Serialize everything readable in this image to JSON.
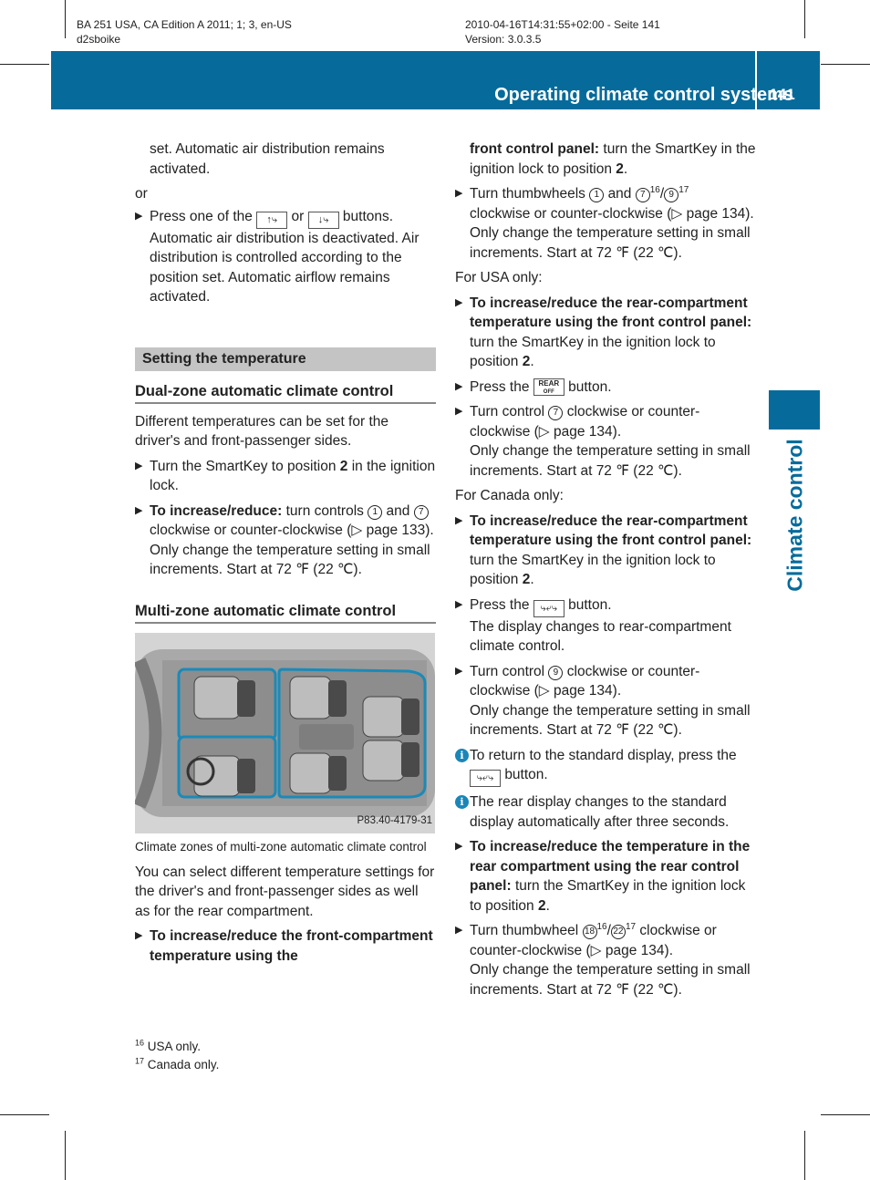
{
  "meta": {
    "left_line1": "BA 251 USA, CA Edition A 2011; 1; 3, en-US",
    "left_line2": "d2sboike",
    "right_line1": "2010-04-16T14:31:55+02:00 - Seite 141",
    "right_line2": "Version: 3.0.3.5"
  },
  "header": {
    "title": "Operating climate control systems",
    "page": "141"
  },
  "side_tab": {
    "label": "Climate control"
  },
  "colors": {
    "brand_blue": "#066b9b",
    "section_gray": "#c4c4c4"
  },
  "left": {
    "cont": "set. Automatic air distribution remains activated.",
    "or": "or",
    "step_press_pre": "Press one of the",
    "btn_a": "↑⤷",
    "step_press_mid": "or",
    "btn_b": "↓⤷",
    "step_press_post": "buttons.",
    "step_press_body": "Automatic air distribution is deactivated. Air distribution is controlled according to the position set. Automatic airflow remains activated.",
    "section_title": "Setting the temperature",
    "dual_heading": "Dual-zone automatic climate control",
    "dual_intro": "Different temperatures can be set for the driver's and front-passenger sides.",
    "dual_step1_pre": "Turn the SmartKey to position",
    "dual_step1_bold": "2",
    "dual_step1_post": "in the ignition lock.",
    "dual_step2_bold": "To increase/reduce:",
    "dual_step2_a": "turn controls",
    "c1": "1",
    "dual_step2_b": "and",
    "c7": "7",
    "dual_step2_c": "clockwise or counter-clockwise (▷ page 133).",
    "dual_step2_d": "Only change the temperature setting in small increments. Start at 72 ℉ (22 ℃).",
    "multi_heading": "Multi-zone automatic climate control",
    "figure_code": "P83.40-4179-31",
    "figure_caption": "Climate zones of multi-zone automatic climate control",
    "multi_intro": "You can select different temperature settings for the driver's and front-passenger sides as well as for the rear compartment.",
    "multi_step_bold": "To increase/reduce the front-compartment temperature using the"
  },
  "right": {
    "cont_bold": "front control panel:",
    "cont_a": "turn the SmartKey in the ignition lock to position",
    "cont_b": "2",
    "thumb_a": "Turn thumbwheels",
    "c1": "1",
    "thumb_and": "and",
    "c7": "7",
    "sup16": "16",
    "c9": "9",
    "sup17": "17",
    "thumb_b": "clockwise or counter-clockwise (▷ page 134).",
    "temp_note": "Only change the temperature setting in small increments. Start at 72 ℉ (22 ℃).",
    "usa_only": "For USA only:",
    "usa_step1_bold": "To increase/reduce the rear-compartment temperature using the front control panel:",
    "usa_step1_a": "turn the SmartKey in the ignition lock to position",
    "pos2": "2",
    "press_the": "Press the",
    "rear_btn_top": "REAR",
    "rear_btn_bot": "OFF",
    "button_word": "button.",
    "usa_step3_a": "Turn control",
    "usa_step3_b": "clockwise or counter-clockwise (▷ page 134).",
    "canada_only": "For Canada only:",
    "rear_clim_btn": "⤷⤶⤷",
    "can_step2_body": "The display changes to rear-compartment climate control.",
    "info1_a": "To return to the standard display, press the",
    "info2": "The rear display changes to the standard display automatically after three seconds.",
    "rear_step_bold": "To increase/reduce the temperature in the rear compartment using the rear control panel:",
    "rear_step_a": "turn the SmartKey in the ignition lock to position",
    "rear_thumb_a": "Turn thumbwheel",
    "c18": "18",
    "c22": "22",
    "rear_thumb_b": "clockwise or counter-clockwise (▷ page 134)."
  },
  "footnotes": [
    {
      "num": "16",
      "text": "USA only."
    },
    {
      "num": "17",
      "text": "Canada only."
    }
  ]
}
